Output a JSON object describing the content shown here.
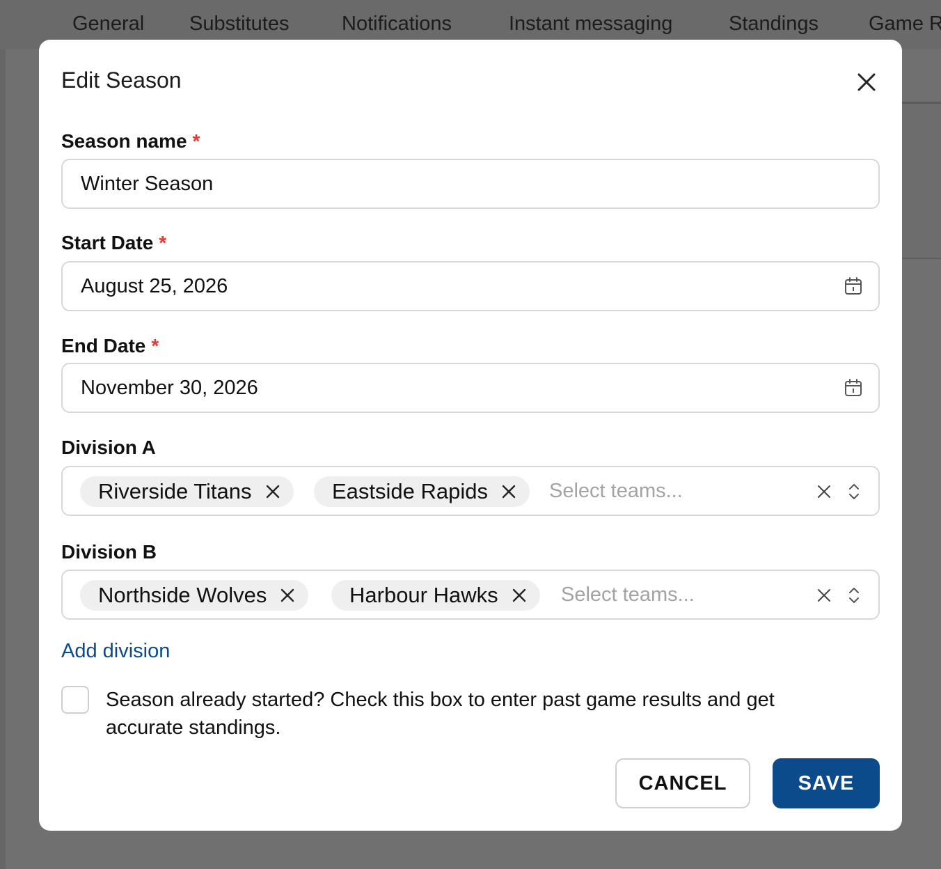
{
  "background_tabs": [
    "General",
    "Substitutes",
    "Notifications",
    "Instant messaging",
    "Standings",
    "Game R"
  ],
  "modal": {
    "title": "Edit Season",
    "close_icon": "close-icon"
  },
  "fields": {
    "season_name": {
      "label": "Season name",
      "required_mark": "*",
      "value": "Winter Season"
    },
    "start_date": {
      "label": "Start Date",
      "required_mark": "*",
      "value": "August 25, 2026",
      "icon": "calendar-icon"
    },
    "end_date": {
      "label": "End Date",
      "required_mark": "*",
      "value": "November 30, 2026",
      "icon": "calendar-icon"
    }
  },
  "divisions": [
    {
      "label": "Division A",
      "teams": [
        "Riverside Titans",
        "Eastside Rapids"
      ],
      "placeholder": "Select teams..."
    },
    {
      "label": "Division B",
      "teams": [
        "Northside Wolves",
        "Harbour Hawks"
      ],
      "placeholder": "Select teams..."
    }
  ],
  "add_division": "Add division",
  "season_started": {
    "checked": false,
    "text": "Season already started? Check this box to enter past game results and get accurate standings."
  },
  "buttons": {
    "cancel": "CANCEL",
    "save": "SAVE"
  },
  "colors": {
    "accent": "#0b4a8b",
    "required": "#e53935",
    "overlay": "#666666"
  }
}
